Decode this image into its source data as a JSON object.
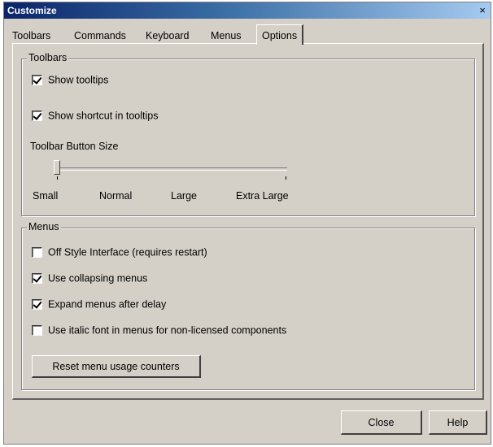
{
  "window": {
    "title": "Customize",
    "close_glyph": "×"
  },
  "tabs": [
    {
      "label": "Toolbars"
    },
    {
      "label": "Commands"
    },
    {
      "label": "Keyboard"
    },
    {
      "label": "Menus"
    },
    {
      "label": "Options",
      "active": true
    }
  ],
  "toolbars_group": {
    "legend": "Toolbars",
    "show_tooltips": {
      "label": "Show tooltips",
      "checked": true
    },
    "show_shortcut": {
      "label": "Show shortcut in tooltips",
      "checked": true
    },
    "button_size_label": "Toolbar Button Size",
    "sizes": [
      "Small",
      "Normal",
      "Large",
      "Extra Large"
    ],
    "selected_size": "Small"
  },
  "menus_group": {
    "legend": "Menus",
    "office_style": {
      "label": "Off Style Interface (requires restart)",
      "checked": false
    },
    "collapsing": {
      "label": "Use collapsing menus",
      "checked": true
    },
    "expand_delay": {
      "label": "Expand menus after delay",
      "checked": true
    },
    "italic_font": {
      "label": "Use italic font in menus for non-licensed components",
      "checked": false
    },
    "reset_button": "Reset menu usage counters"
  },
  "footer": {
    "close_button": "Close",
    "help_button": "Help"
  },
  "colors": {
    "face": "#d4d0c8",
    "title_start": "#0a246a",
    "title_end": "#a6caf0"
  }
}
